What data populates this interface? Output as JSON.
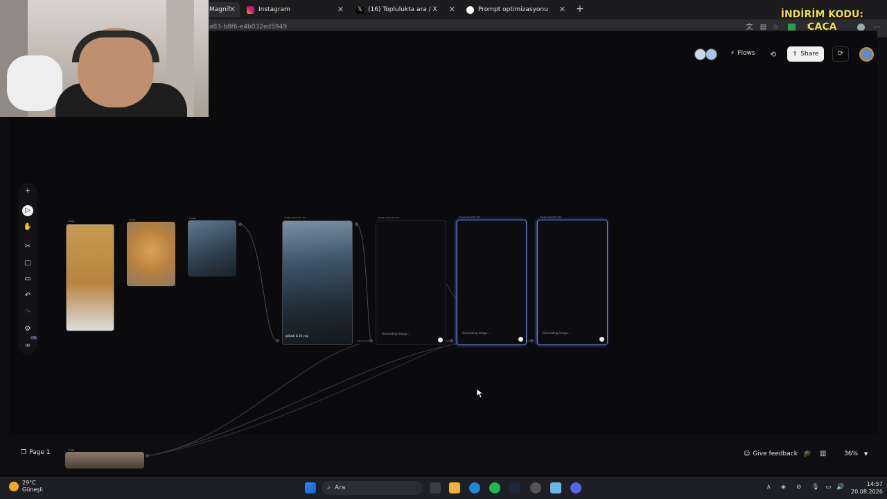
{
  "browser": {
    "tabs": [
      {
        "label": "Magnific",
        "active": true
      },
      {
        "label": "Instagram"
      },
      {
        "label": "(16) Toplulukta ara / X"
      },
      {
        "label": "Prompt optimizasyonu"
      }
    ],
    "new_tab": "+",
    "url_fragment": "a83-b8f6-e4b032ed5949"
  },
  "overlay": {
    "promo_line1": "İNDİRİM KODU:",
    "promo_line2": "ÇAÇA"
  },
  "header": {
    "flows_label": "Flows",
    "share_label": "Share"
  },
  "toolbar": {
    "items": [
      "add",
      "select",
      "hand",
      "scissors",
      "frame",
      "comment",
      "undo",
      "redo",
      "settings",
      "infinite"
    ],
    "badge": "ON"
  },
  "canvas": {
    "nodes": [
      {
        "kind": "image",
        "title": "Image"
      },
      {
        "kind": "image",
        "title": "Image"
      },
      {
        "kind": "image",
        "title": "Image"
      },
      {
        "kind": "generator",
        "title": "Image Generator #1",
        "caption": "gökadı & 10 yaşı"
      },
      {
        "kind": "generator",
        "title": "Image Generator #2",
        "status": "Generating Image..."
      },
      {
        "kind": "generator",
        "title": "Image Generator #3",
        "status": "Generating Image..."
      },
      {
        "kind": "generator",
        "title": "Image Generator #4",
        "status": "Generating Image..."
      },
      {
        "kind": "image",
        "title": "Image"
      }
    ]
  },
  "footer": {
    "page_label": "Page 1",
    "feedback_label": "Give feedback",
    "zoom": "36%"
  },
  "taskbar": {
    "weather_temp": "29°C",
    "weather_desc": "Güneşli",
    "search_placeholder": "Ara",
    "time": "14:57",
    "date": "20.08.2026"
  },
  "colors": {
    "accent": "#6a7fd8",
    "share_bg": "#f1f1f1",
    "promo": "#f4e046"
  }
}
